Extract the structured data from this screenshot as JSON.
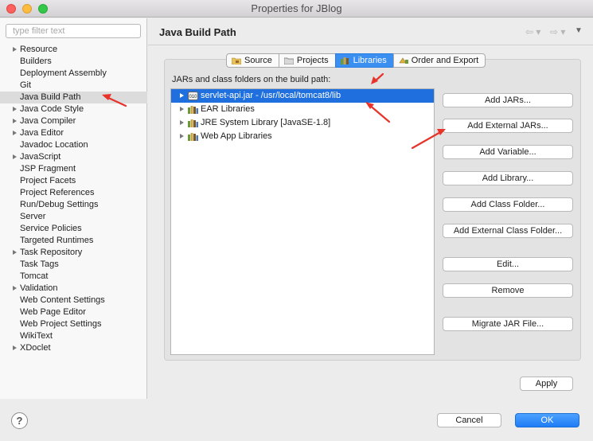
{
  "window": {
    "title": "Properties for JBlog"
  },
  "sidebar": {
    "filter_placeholder": "type filter text",
    "items": [
      {
        "label": "Resource",
        "expandable": true
      },
      {
        "label": "Builders"
      },
      {
        "label": "Deployment Assembly"
      },
      {
        "label": "Git"
      },
      {
        "label": "Java Build Path",
        "selected": true
      },
      {
        "label": "Java Code Style",
        "expandable": true
      },
      {
        "label": "Java Compiler",
        "expandable": true
      },
      {
        "label": "Java Editor",
        "expandable": true
      },
      {
        "label": "Javadoc Location"
      },
      {
        "label": "JavaScript",
        "expandable": true
      },
      {
        "label": "JSP Fragment"
      },
      {
        "label": "Project Facets"
      },
      {
        "label": "Project References"
      },
      {
        "label": "Run/Debug Settings"
      },
      {
        "label": "Server"
      },
      {
        "label": "Service Policies"
      },
      {
        "label": "Targeted Runtimes"
      },
      {
        "label": "Task Repository",
        "expandable": true
      },
      {
        "label": "Task Tags"
      },
      {
        "label": "Tomcat"
      },
      {
        "label": "Validation",
        "expandable": true
      },
      {
        "label": "Web Content Settings"
      },
      {
        "label": "Web Page Editor"
      },
      {
        "label": "Web Project Settings"
      },
      {
        "label": "WikiText"
      },
      {
        "label": "XDoclet",
        "expandable": true
      }
    ]
  },
  "header": {
    "title": "Java Build Path",
    "back": "⇦ ▾",
    "forward": "⇨ ▾",
    "menu": "▼"
  },
  "tabs": [
    {
      "label": "Source",
      "icon": "source-folder-icon"
    },
    {
      "label": "Projects",
      "icon": "projects-folder-icon"
    },
    {
      "label": "Libraries",
      "icon": "libraries-icon",
      "active": true
    },
    {
      "label": "Order and Export",
      "icon": "order-export-icon"
    }
  ],
  "libraries": {
    "description": "JARs and class folders on the build path:",
    "entries": [
      {
        "label": "servlet-api.jar - /usr/local/tomcat8/lib",
        "icon": "jar-icon",
        "selected": true
      },
      {
        "label": "EAR Libraries",
        "icon": "library-icon"
      },
      {
        "label": "JRE System Library [JavaSE-1.8]",
        "icon": "library-icon"
      },
      {
        "label": "Web App Libraries",
        "icon": "library-icon"
      }
    ]
  },
  "buttons": {
    "add_jars": "Add JARs...",
    "add_external_jars": "Add External JARs...",
    "add_variable": "Add Variable...",
    "add_library": "Add Library...",
    "add_class_folder": "Add Class Folder...",
    "add_external_class_folder": "Add External Class Folder...",
    "edit": "Edit...",
    "remove": "Remove",
    "migrate_jar": "Migrate JAR File..."
  },
  "footer": {
    "apply": "Apply",
    "cancel": "Cancel",
    "ok": "OK",
    "help": "?"
  },
  "colors": {
    "accent": "#1f6fde",
    "annotation": "#e8332a"
  }
}
